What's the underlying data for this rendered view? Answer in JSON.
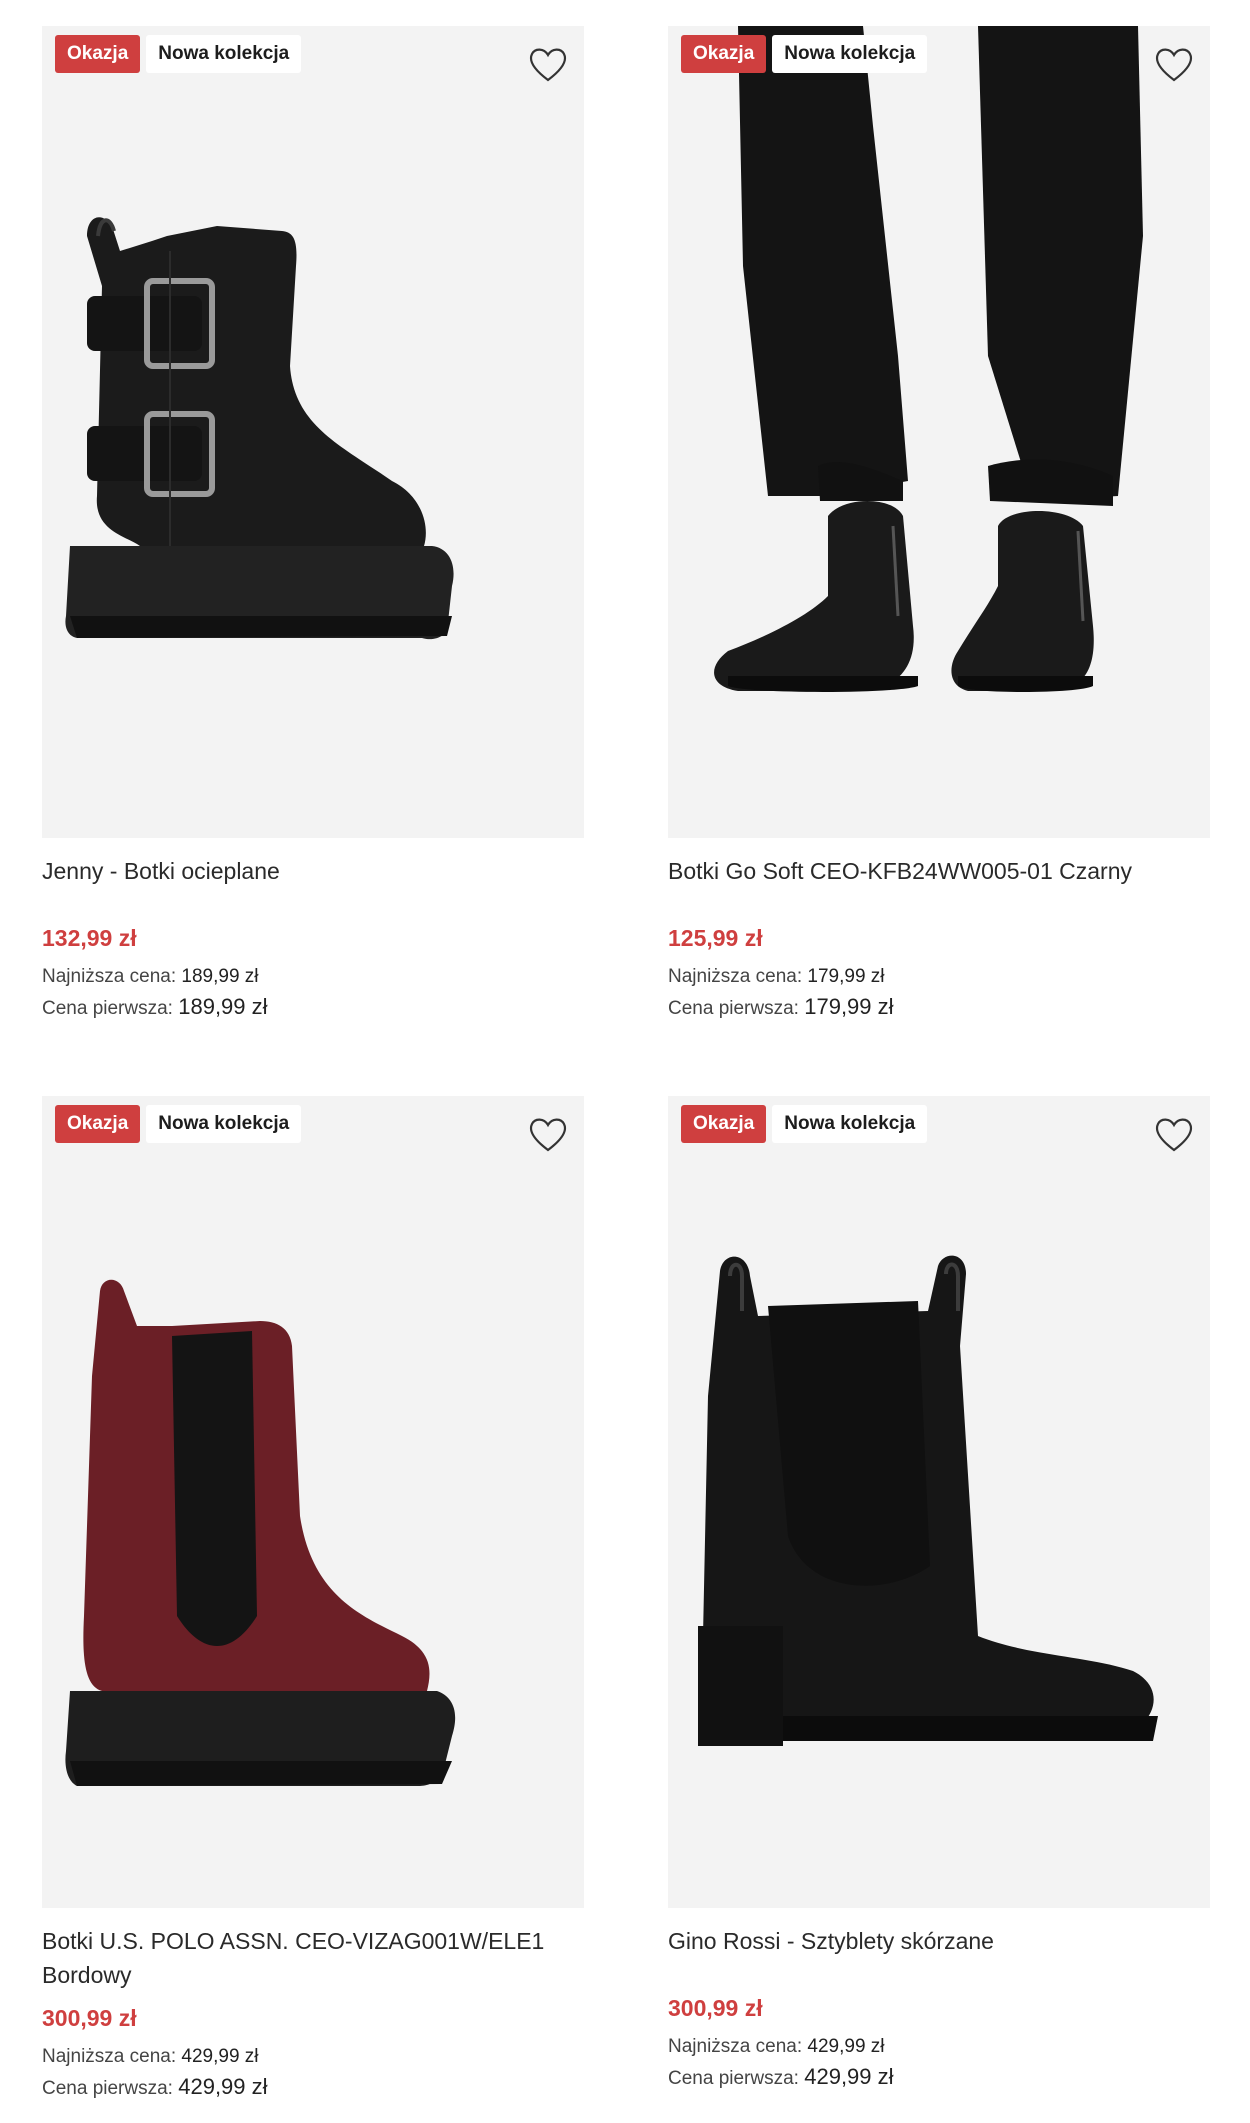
{
  "badges": {
    "sale": "Okazja",
    "new": "Nowa kolekcja"
  },
  "labels": {
    "lowest": "Najniższa cena:",
    "first": "Cena pierwsza:"
  },
  "products": [
    {
      "name": "Jenny - Botki ocieplane",
      "price": "132,99 zł",
      "lowest": "189,99 zł",
      "first": "189,99 zł"
    },
    {
      "name": "Botki Go Soft CEO-KFB24WW005-01 Czarny",
      "price": "125,99 zł",
      "lowest": "179,99 zł",
      "first": "179,99 zł"
    },
    {
      "name": "Botki U.S. POLO ASSN. CEO-VIZAG001W/ELE1 Bordowy",
      "price": "300,99 zł",
      "lowest": "429,99 zł",
      "first": "429,99 zł"
    },
    {
      "name": "Gino Rossi - Sztyblety skórzane",
      "price": "300,99 zł",
      "lowest": "429,99 zł",
      "first": "429,99 zł"
    }
  ],
  "colors": {
    "sale_red": "#cf3f3f",
    "card_bg": "#f3f3f3",
    "text": "#2a2a2a"
  },
  "icons": {
    "wishlist": "heart-icon"
  }
}
